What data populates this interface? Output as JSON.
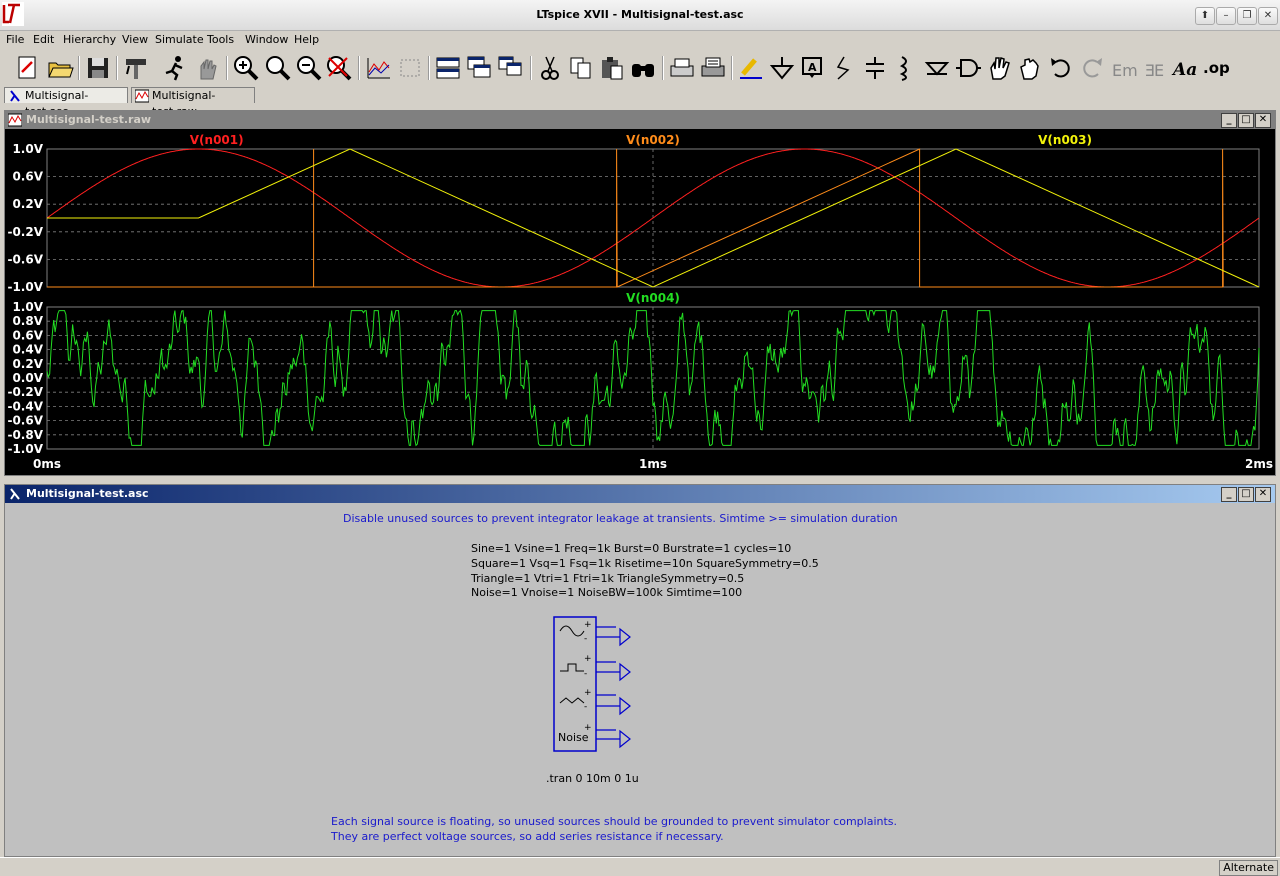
{
  "app": {
    "title": "LTspice XVII - Multisignal-test.asc",
    "window_controls": [
      "⬆",
      "–",
      "❐",
      "✕"
    ]
  },
  "menu": [
    "File",
    "Edit",
    "Hierarchy",
    "View",
    "Simulate",
    "Tools",
    "Window",
    "Help"
  ],
  "toolbar": {
    "tools": [
      "new-schematic-icon",
      "open-folder-icon",
      "save-icon",
      "control-panel-hammer-icon",
      "run-icon",
      "halt-hand-icon",
      "zoom-in-icon",
      "zoom-area-icon",
      "zoom-out-icon",
      "zoom-cancel-icon",
      "autorange-icon",
      "fit-icon",
      "tile-horizontal-icon",
      "cascade-icon",
      "tile-vertical-icon",
      "cut-icon",
      "copy-icon",
      "paste-icon",
      "find-icon",
      "print-preview-icon",
      "print-icon",
      "draw-wire-icon",
      "ground-icon",
      "label-net-icon",
      "resistor-icon",
      "capacitor-icon",
      "inductor-icon",
      "diode-icon",
      "component-icon",
      "move-hand-icon",
      "drag-hand-icon",
      "undo-icon",
      "redo-icon",
      "rotate-icon",
      "mirror-icon",
      "text-icon",
      "spice-directive-icon"
    ]
  },
  "tabs": [
    {
      "label": "Multisignal-test.asc",
      "active": true
    },
    {
      "label": "Multisignal-test.raw",
      "active": false
    }
  ],
  "waveform_window": {
    "title": "Multisignal-test.raw",
    "chart_data": [
      {
        "type": "line",
        "title": "",
        "xlabel": "",
        "ylabel": "",
        "xlim": [
          0,
          2
        ],
        "x_unit": "ms",
        "ylim": [
          -1.0,
          1.0
        ],
        "y_ticks": [
          "1.0V",
          "0.6V",
          "0.2V",
          "-0.2V",
          "-0.6V",
          "-1.0V"
        ],
        "grid": true,
        "series": [
          {
            "name": "V(n001)",
            "color": "#ff2020",
            "shape": "sine",
            "freq_khz": 1,
            "amplitude": 1
          },
          {
            "name": "V(n002)",
            "color": "#ff8c1a",
            "shape": "square",
            "freq_khz": 1,
            "amplitude": 1
          },
          {
            "name": "V(n003)",
            "color": "#f2f20a",
            "shape": "triangle",
            "freq_khz": 1,
            "amplitude": 1
          }
        ]
      },
      {
        "type": "line",
        "title": "",
        "xlabel": "",
        "ylabel": "",
        "xlim": [
          0,
          2
        ],
        "x_unit": "ms",
        "ylim": [
          -1.0,
          1.0
        ],
        "y_ticks": [
          "1.0V",
          "0.8V",
          "0.6V",
          "0.4V",
          "0.2V",
          "0.0V",
          "-0.2V",
          "-0.4V",
          "-0.6V",
          "-0.8V",
          "-1.0V"
        ],
        "x_ticks": [
          "0ms",
          "1ms",
          "2ms"
        ],
        "grid": true,
        "series": [
          {
            "name": "V(n004)",
            "color": "#22dd22",
            "shape": "noise",
            "bandwidth_khz": 100,
            "amplitude": 1
          }
        ]
      }
    ]
  },
  "schematic_window": {
    "title": "Multisignal-test.asc",
    "note_top": "Disable unused sources to prevent integrator leakage at transients. Simtime >= simulation duration",
    "params": [
      "Sine=1 Vsine=1 Freq=1k Burst=0 Burstrate=1 cycles=10",
      "Square=1 Vsq=1 Fsq=1k Risetime=10n SquareSymmetry=0.5",
      "Triangle=1 Vtri=1 Ftri=1k TriangleSymmetry=0.5",
      "Noise=1 Vnoise=1 NoiseBW=100k Simtime=100"
    ],
    "symbol_label": "Noise",
    "tran": ".tran 0 10m 0 1u",
    "note_bottom": [
      "Each signal source is floating, so unused sources should be grounded to prevent simulator complaints.",
      "They are perfect voltage sources, so add series resistance if necessary."
    ],
    "note_color": "#1a1acc"
  },
  "status": {
    "mode": "Alternate"
  }
}
